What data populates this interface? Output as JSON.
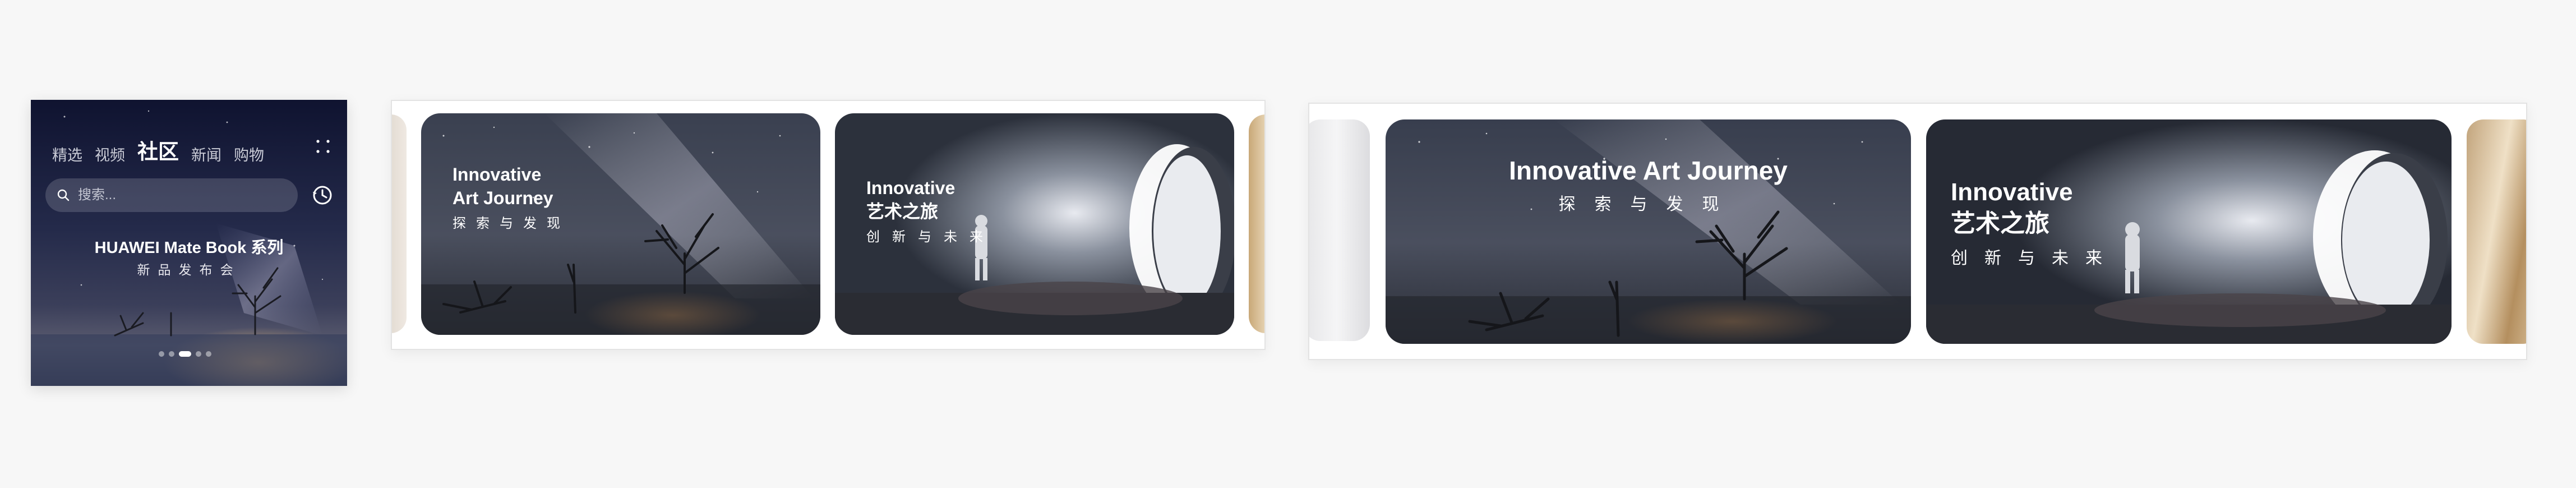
{
  "phone": {
    "tabs": [
      {
        "label": "精选",
        "active": false
      },
      {
        "label": "视频",
        "active": false
      },
      {
        "label": "社区",
        "active": true
      },
      {
        "label": "新闻",
        "active": false
      },
      {
        "label": "购物",
        "active": false
      }
    ],
    "search_placeholder": "搜索...",
    "banner_title": "HUAWEI Mate Book 系列",
    "banner_subtitle": "新品发布会",
    "page_indicator": {
      "count": 5,
      "active_index": 2
    }
  },
  "carousel_small": {
    "card1": {
      "title_line1": "Innovative",
      "title_line2": "Art Journey",
      "subtitle": "探索与发现"
    },
    "card2": {
      "title_line1": "Innovative",
      "title_line2": "艺术之旅",
      "subtitle": "创新与未来"
    }
  },
  "carousel_large": {
    "card1": {
      "title": "Innovative Art Journey",
      "subtitle": "探索与发现"
    },
    "card2": {
      "title_line1": "Innovative",
      "title_line2": "艺术之旅",
      "subtitle": "创新与未来"
    }
  },
  "colors": {
    "page_bg": "#f7f7f7",
    "active_dot": "#ffffff",
    "card_sky": "#2e3443"
  }
}
